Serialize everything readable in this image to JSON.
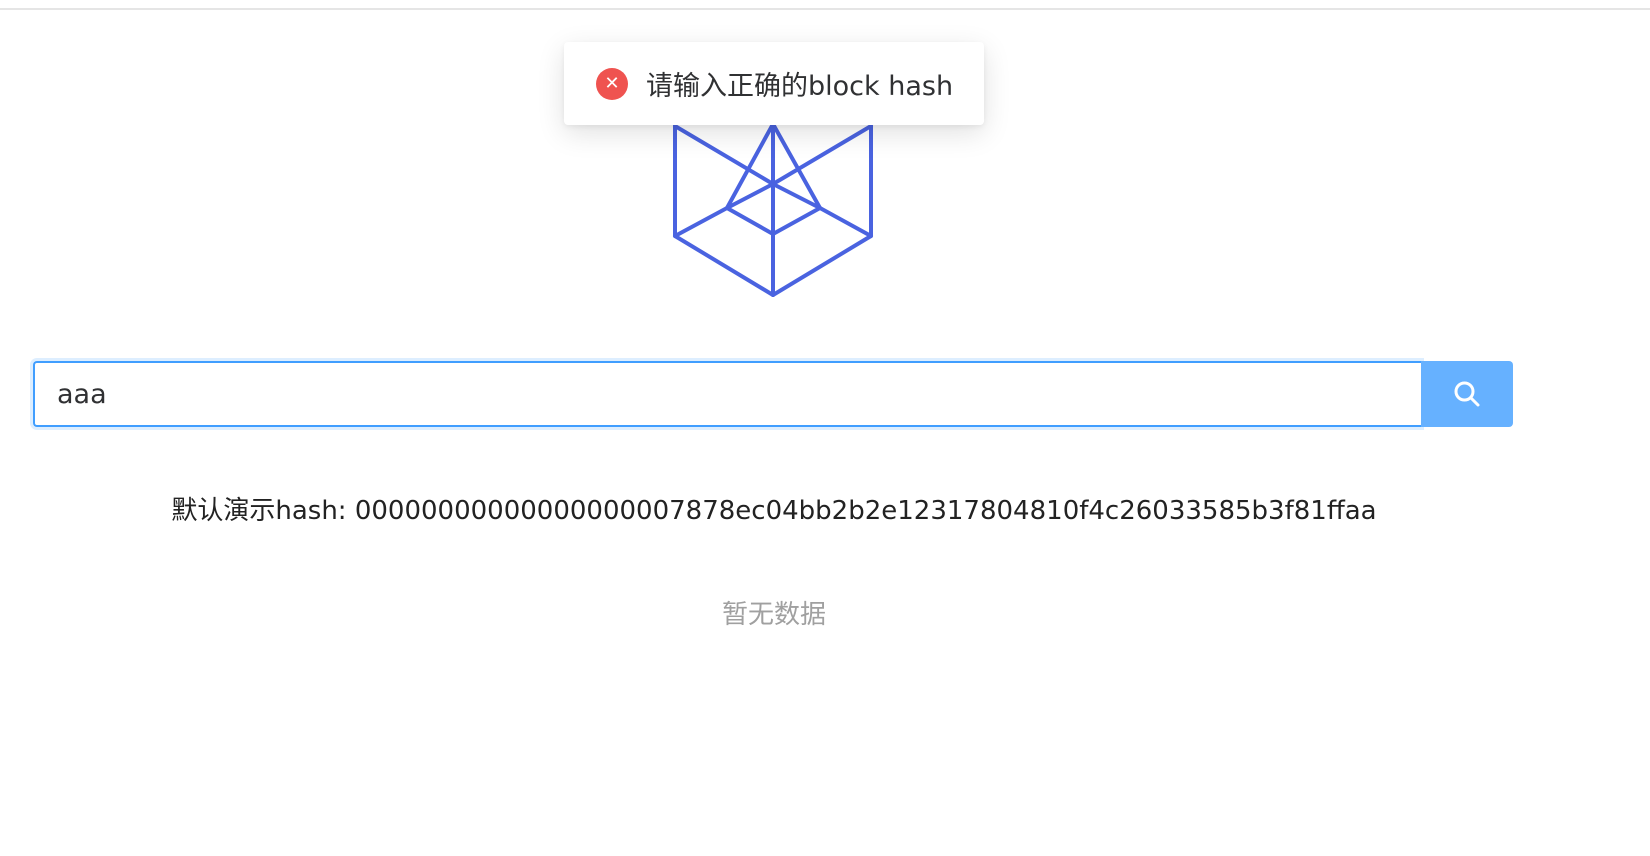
{
  "toast": {
    "message": "请输入正确的block hash",
    "icon": "error-circle-icon",
    "color": "#ef5350"
  },
  "logo": {
    "icon": "cube-network-logo",
    "color": "#4a63e0"
  },
  "search": {
    "value": "aaa",
    "placeholder": "",
    "button_icon": "search-icon",
    "accent_color": "#409eff",
    "button_color": "#66b1ff"
  },
  "demo": {
    "text": "默认演示hash: 00000000000000000007878ec04bb2b2e12317804810f4c26033585b3f81ffaa"
  },
  "result": {
    "empty_text": "暂无数据"
  }
}
